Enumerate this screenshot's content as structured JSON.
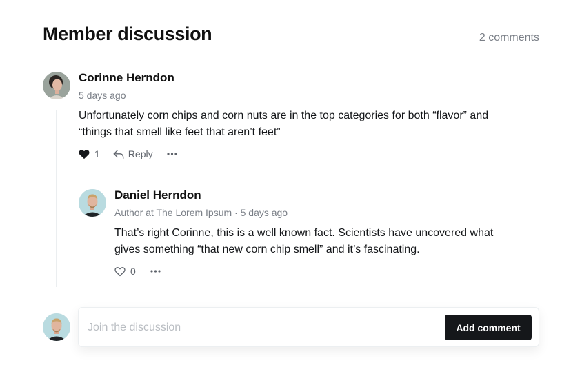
{
  "header": {
    "title": "Member discussion",
    "count": "2 comments"
  },
  "comments": [
    {
      "name": "Corinne Herndon",
      "meta": "5 days ago",
      "text": "Unfortunately corn chips and corn nuts are in the top categories for both “flavor” and “things that smell like feet that aren’t feet”",
      "likes": "1",
      "reply_label": "Reply",
      "more_icon": "more-icon"
    },
    {
      "name": "Daniel Herndon",
      "meta": "Author at The Lorem Ipsum · 5 days ago",
      "text": "That’s right Corinne, this is a well known fact. Scientists have uncovered what gives something “that new corn chip smell” and it’s fascinating.",
      "likes": "0",
      "more_icon": "more-icon"
    }
  ],
  "composer": {
    "placeholder": "Join the discussion",
    "button": "Add comment"
  },
  "colors": {
    "accent": "#15171a",
    "muted": "#7a7f87",
    "thread_line": "#ebeef0"
  }
}
